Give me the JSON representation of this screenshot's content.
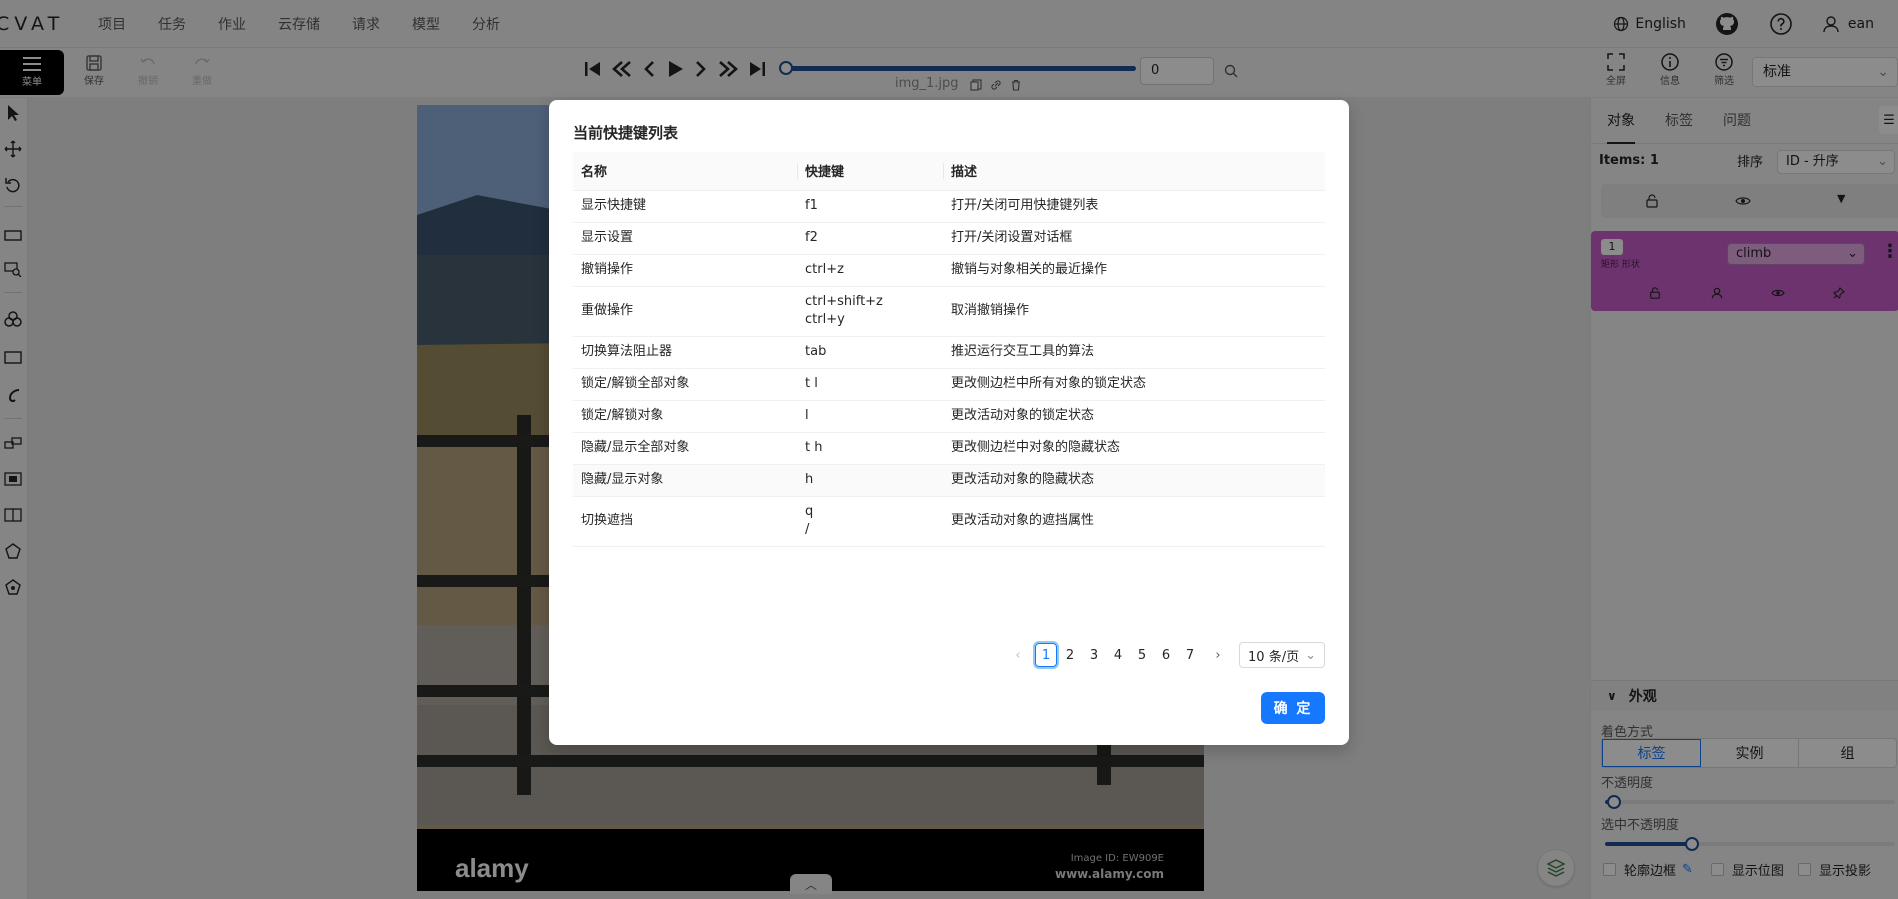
{
  "app": {
    "logo": "CVAT"
  },
  "nav": {
    "items": [
      "项目",
      "任务",
      "作业",
      "云存储",
      "请求",
      "模型",
      "分析"
    ],
    "language": "English",
    "user": "ean"
  },
  "toolbar": {
    "menu_label": "菜单",
    "save_label": "保存",
    "undo_label": "撤销",
    "redo_label": "重做",
    "frame_value": "0",
    "filename": "img_1.jpg",
    "fullscreen_label": "全屏",
    "info_label": "信息",
    "filter_label": "筛选",
    "workspace_select": "标准"
  },
  "sidebar": {
    "tabs": [
      "对象",
      "标签",
      "问题"
    ],
    "items_count": "Items: 1",
    "sort_label": "排序",
    "sort_value": "ID - 升序",
    "object": {
      "id": "1",
      "type": "矩形 形状",
      "label": "climb"
    },
    "appearance": {
      "title": "外观",
      "color_by_label": "着色方式",
      "color_by_options": [
        "标签",
        "实例",
        "组"
      ],
      "opacity_label": "不透明度",
      "selected_opacity_label": "选中不透明度",
      "opacity_value": 0.03,
      "selected_opacity_value": 0.3,
      "checkboxes": [
        "轮廓边框",
        "显示位图",
        "显示投影"
      ]
    }
  },
  "modal": {
    "title": "当前快捷键列表",
    "columns": [
      "名称",
      "快捷键",
      "描述"
    ],
    "rows": [
      {
        "name": "显示快捷键",
        "keys": [
          "f1"
        ],
        "desc": "打开/关闭可用快捷键列表"
      },
      {
        "name": "显示设置",
        "keys": [
          "f2"
        ],
        "desc": "打开/关闭设置对话框"
      },
      {
        "name": "撤销操作",
        "keys": [
          "ctrl+z"
        ],
        "desc": "撤销与对象相关的最近操作"
      },
      {
        "name": "重做操作",
        "keys": [
          "ctrl+shift+z",
          "ctrl+y"
        ],
        "desc": "取消撤销操作"
      },
      {
        "name": "切换算法阻止器",
        "keys": [
          "tab"
        ],
        "desc": "推迟运行交互工具的算法"
      },
      {
        "name": "锁定/解锁全部对象",
        "keys": [
          "t l"
        ],
        "desc": "更改侧边栏中所有对象的锁定状态"
      },
      {
        "name": "锁定/解锁对象",
        "keys": [
          "l"
        ],
        "desc": "更改活动对象的锁定状态"
      },
      {
        "name": "隐藏/显示全部对象",
        "keys": [
          "t h"
        ],
        "desc": "更改侧边栏中对象的隐藏状态"
      },
      {
        "name": "隐藏/显示对象",
        "keys": [
          "h"
        ],
        "desc": "更改活动对象的隐藏状态"
      },
      {
        "name": "切换遮挡",
        "keys": [
          "q",
          "/"
        ],
        "desc": "更改活动对象的遮挡属性"
      }
    ],
    "pages": [
      "1",
      "2",
      "3",
      "4",
      "5",
      "6",
      "7"
    ],
    "current_page": "1",
    "page_size": "10 条/页",
    "ok_label": "确 定"
  },
  "photo": {
    "watermark": "alamy",
    "image_id": "Image ID: EW909E",
    "site": "www.alamy.com"
  },
  "colors": {
    "accent": "#1677ff",
    "object": "#c65ec8",
    "menu": "#000000"
  }
}
